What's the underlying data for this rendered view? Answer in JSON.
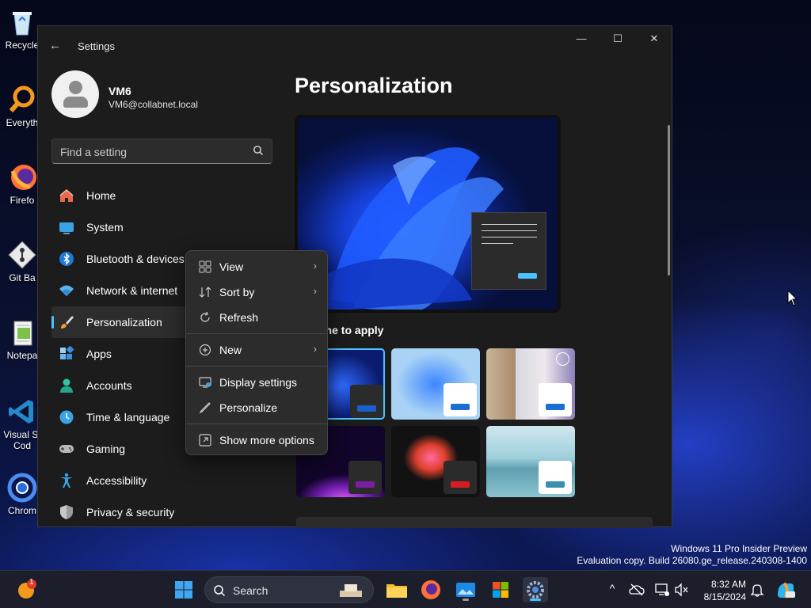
{
  "desktop": {
    "icons": [
      {
        "label": "Recycle",
        "icon": "recycle-bin-icon"
      },
      {
        "label": "Everyth",
        "icon": "everything-search-icon"
      },
      {
        "label": "Firefo",
        "icon": "firefox-icon"
      },
      {
        "label": "Git Ba",
        "icon": "git-bash-icon"
      },
      {
        "label": "Notepa",
        "icon": "notepad-icon"
      },
      {
        "label": "Visual St",
        "label2": "Cod",
        "icon": "vscode-icon"
      },
      {
        "label": "Chrom",
        "icon": "chrome-icon"
      }
    ],
    "watermark": {
      "line1": "Windows 11 Pro Insider Preview",
      "line2": "Evaluation copy. Build 26080.ge_release.240308-1400"
    }
  },
  "window": {
    "title": "Settings",
    "controls": {
      "minimize": "—",
      "maximize": "☐",
      "close": "✕"
    },
    "back_glyph": "←"
  },
  "profile": {
    "name": "VM6",
    "email": "VM6@collabnet.local"
  },
  "search": {
    "placeholder": "Find a setting"
  },
  "nav": {
    "items": [
      {
        "label": "Home",
        "icon": "home-icon",
        "active": false
      },
      {
        "label": "System",
        "icon": "system-display-icon",
        "active": false
      },
      {
        "label": "Bluetooth & devices",
        "icon": "bluetooth-icon",
        "active": false
      },
      {
        "label": "Network & internet",
        "icon": "wifi-icon",
        "active": false
      },
      {
        "label": "Personalization",
        "icon": "paintbrush-icon",
        "active": true
      },
      {
        "label": "Apps",
        "icon": "apps-icon",
        "active": false
      },
      {
        "label": "Accounts",
        "icon": "accounts-icon",
        "active": false
      },
      {
        "label": "Time & language",
        "icon": "clock-globe-icon",
        "active": false
      },
      {
        "label": "Gaming",
        "icon": "gamepad-icon",
        "active": false
      },
      {
        "label": "Accessibility",
        "icon": "accessibility-icon",
        "active": false
      },
      {
        "label": "Privacy & security",
        "icon": "shield-icon",
        "active": false
      }
    ]
  },
  "main": {
    "title": "Personalization",
    "themes_label": "a theme to apply",
    "themes": [
      {
        "name": "theme-windows-dark",
        "accent": "#1a5fd0"
      },
      {
        "name": "theme-windows-light",
        "accent": "#1a6fd6"
      },
      {
        "name": "theme-captured-motion",
        "accent": "#1a6fd6"
      },
      {
        "name": "theme-glow",
        "accent": "#7b1fa2"
      },
      {
        "name": "theme-flow",
        "accent": "#d81b24"
      },
      {
        "name": "theme-sunrise",
        "accent": "#3a8fb0"
      }
    ]
  },
  "context_menu": {
    "items": [
      {
        "label": "View",
        "icon": "view-grid-icon",
        "submenu": true
      },
      {
        "label": "Sort by",
        "icon": "sort-icon",
        "submenu": true
      },
      {
        "label": "Refresh",
        "icon": "refresh-icon",
        "submenu": false
      },
      {
        "label": "New",
        "icon": "new-plus-icon",
        "submenu": true
      },
      {
        "label": "Display settings",
        "icon": "display-settings-icon",
        "submenu": false
      },
      {
        "label": "Personalize",
        "icon": "personalize-pen-icon",
        "submenu": false
      },
      {
        "label": "Show more options",
        "icon": "show-more-options-icon",
        "submenu": false
      }
    ],
    "chevron": "›"
  },
  "taskbar": {
    "search_placeholder": "Search",
    "notification_badge": "1",
    "clock_time": "8:32 AM",
    "clock_date": "8/15/2024",
    "apps": [
      "start-icon",
      "file-explorer-icon",
      "firefox-icon",
      "photos-icon",
      "microsoft-store-icon",
      "settings-icon"
    ],
    "tray_chevron": "^"
  },
  "colors": {
    "accent": "#4cc2ff",
    "window_bg": "#1c1c1c",
    "menu_bg": "#2c2c2c"
  }
}
